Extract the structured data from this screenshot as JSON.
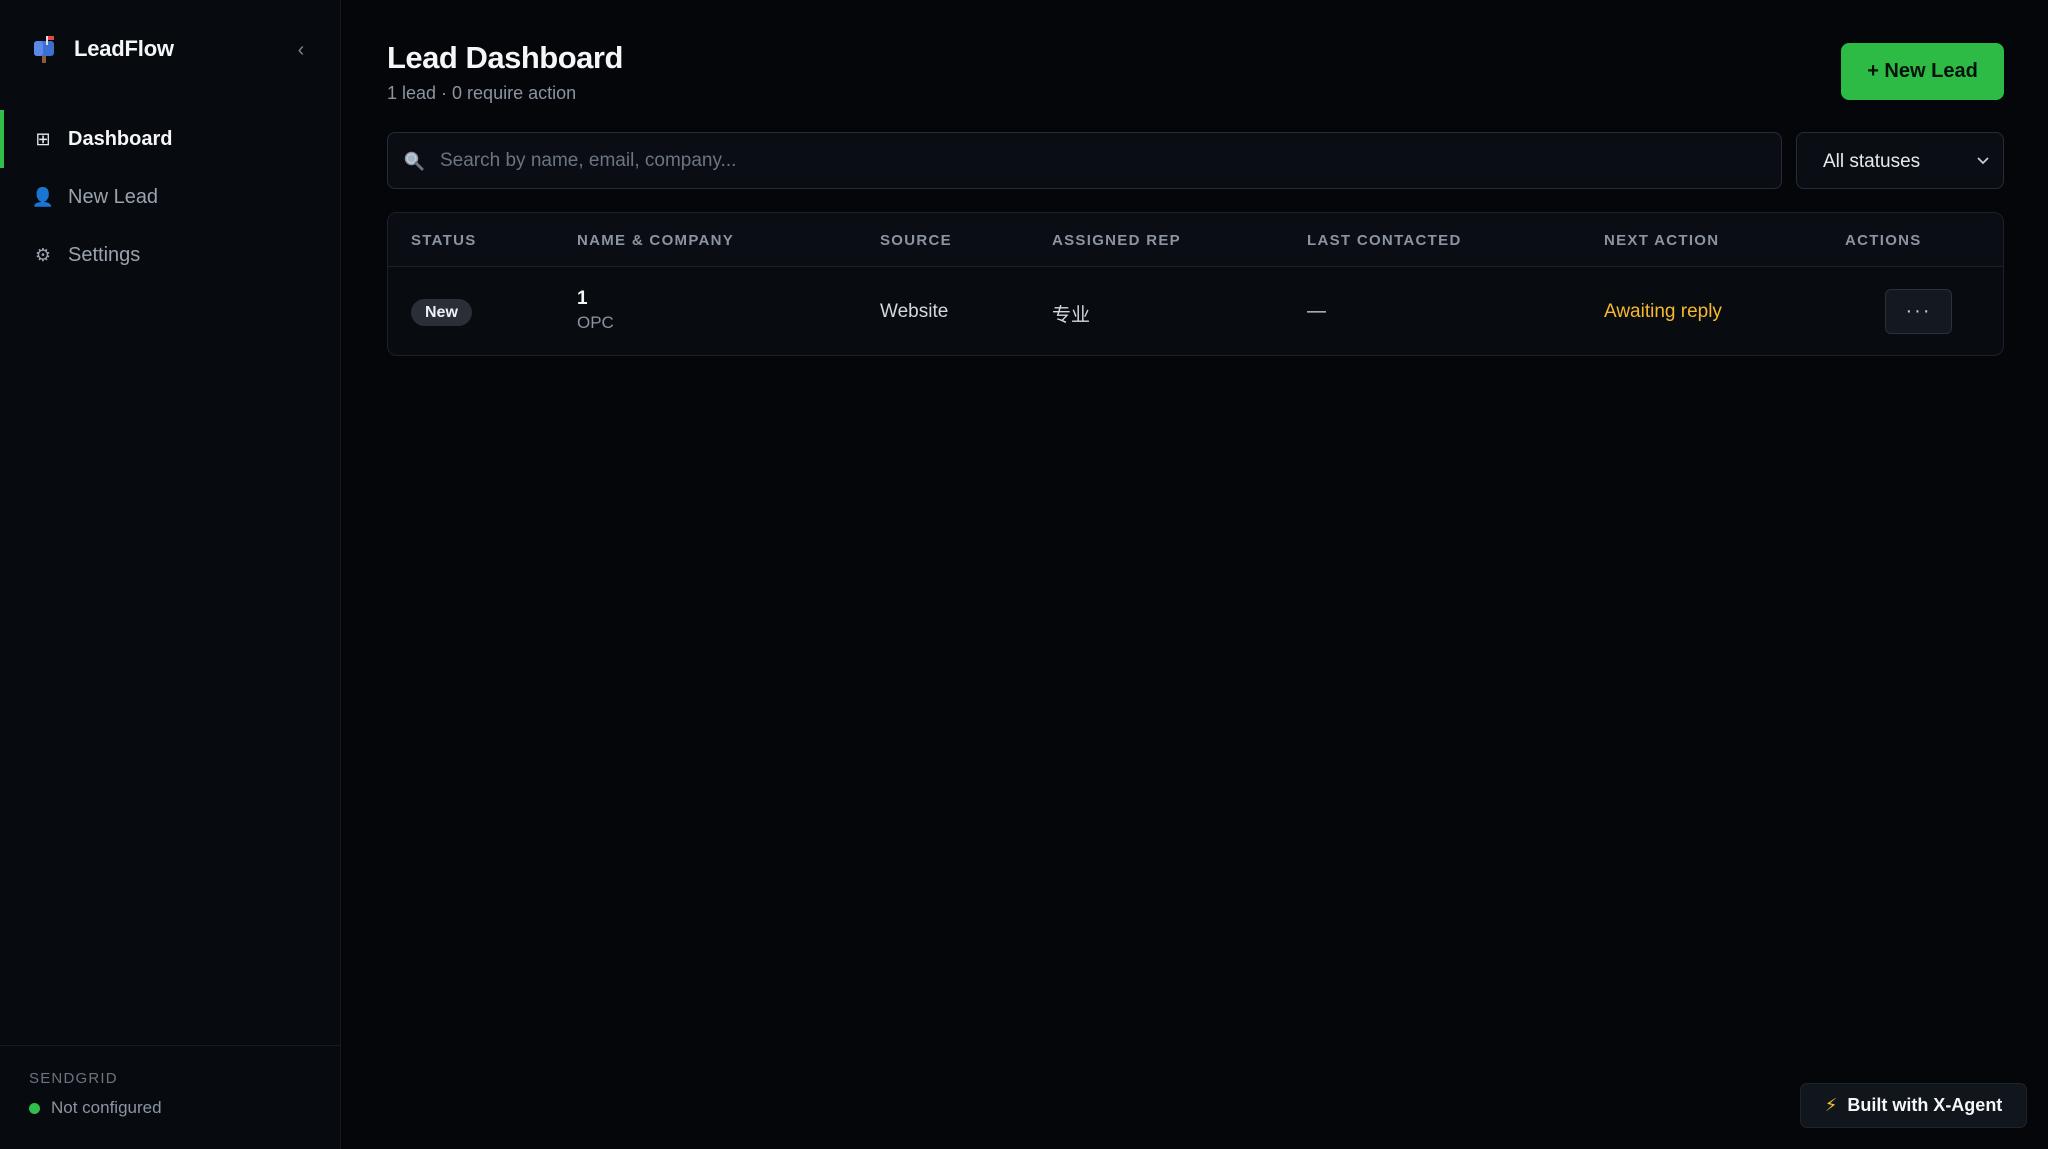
{
  "app": {
    "name": "LeadFlow",
    "logo_icon": "mailbox-icon",
    "collapse_glyph": "‹"
  },
  "sidebar": {
    "items": [
      {
        "label": "Dashboard",
        "icon": "grid-icon",
        "glyph": "⊞",
        "active": true
      },
      {
        "label": "New Lead",
        "icon": "user-icon",
        "glyph": "👤",
        "active": false
      },
      {
        "label": "Settings",
        "icon": "gear-icon",
        "glyph": "⚙",
        "active": false
      }
    ],
    "footer": {
      "title": "SENDGRID",
      "status": "Not configured",
      "status_color": "#2fbf4a"
    }
  },
  "header": {
    "title": "Lead Dashboard",
    "subtitle": "1 lead · 0 require action",
    "new_lead_label": "+ New Lead"
  },
  "search": {
    "placeholder": "Search by name, email, company..."
  },
  "filter": {
    "selected": "All statuses"
  },
  "table": {
    "columns": [
      "STATUS",
      "NAME & COMPANY",
      "SOURCE",
      "ASSIGNED REP",
      "LAST CONTACTED",
      "NEXT ACTION",
      "ACTIONS"
    ],
    "rows": [
      {
        "status": "New",
        "name": "1",
        "company": "OPC",
        "source": "Website",
        "rep": "专业",
        "last_contacted": "—",
        "next_action": "Awaiting reply",
        "actions_label": "···"
      }
    ]
  },
  "built_badge": {
    "icon_glyph": "⚡",
    "label": "Built with X-Agent"
  },
  "colors": {
    "accent": "#2dbb46",
    "warning": "#f5b82e",
    "background": "#04060a"
  }
}
